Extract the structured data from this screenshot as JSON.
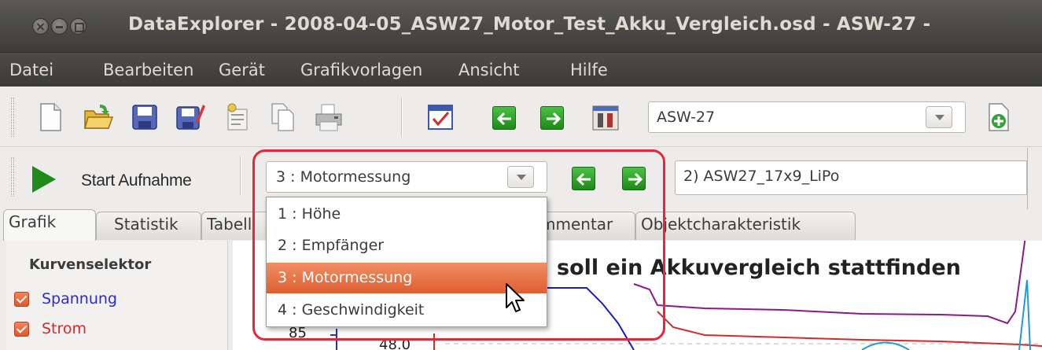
{
  "window": {
    "title": "DataExplorer - 2008-04-05_ASW27_Motor_Test_Akku_Vergleich.osd - ASW-27 -"
  },
  "menu": [
    "Datei",
    "Bearbeiten",
    "Gerät",
    "Grafikvorlagen",
    "Ansicht",
    "Hilfe"
  ],
  "toolbar": {
    "tools": [
      "new-file-icon",
      "open-folder-icon",
      "save-icon",
      "save-as-icon",
      "settings-icon",
      "copy-icon",
      "print-icon",
      "device-select-icon",
      "arrow-left-icon",
      "arrow-right-icon",
      "device-tools-icon"
    ],
    "device_combo": {
      "value": "ASW-27"
    }
  },
  "record_bar": {
    "start_label": "Start Aufnahme",
    "channel_combo": {
      "value": "3 : Motormessung"
    },
    "record_combo": {
      "value": "2) ASW27_17x9_LiPo"
    }
  },
  "tabs": [
    "Grafik",
    "Statistik",
    "Tabell",
    "mmentar",
    "Objektcharakteristik"
  ],
  "curve_selector": {
    "title": "Kurvenselektor",
    "items": [
      {
        "label": "Spannung",
        "color": "#2a2ad6",
        "checked": true
      },
      {
        "label": "Strom",
        "color": "#d62a2a",
        "checked": true
      }
    ]
  },
  "graph": {
    "title": "soll ein Akkuvergleich stattfinden",
    "tick_labels": [
      "85",
      "48.0"
    ]
  },
  "dropdown": {
    "options": [
      "1 : Höhe",
      "2 : Empfänger",
      "3 : Motormessung",
      "4 : Geschwindigkeit"
    ],
    "selected": "3 : Motormessung"
  },
  "colors": {
    "accent": "#e35f32",
    "highlight": "#e4283a",
    "titlebar": "#3c3b37"
  }
}
